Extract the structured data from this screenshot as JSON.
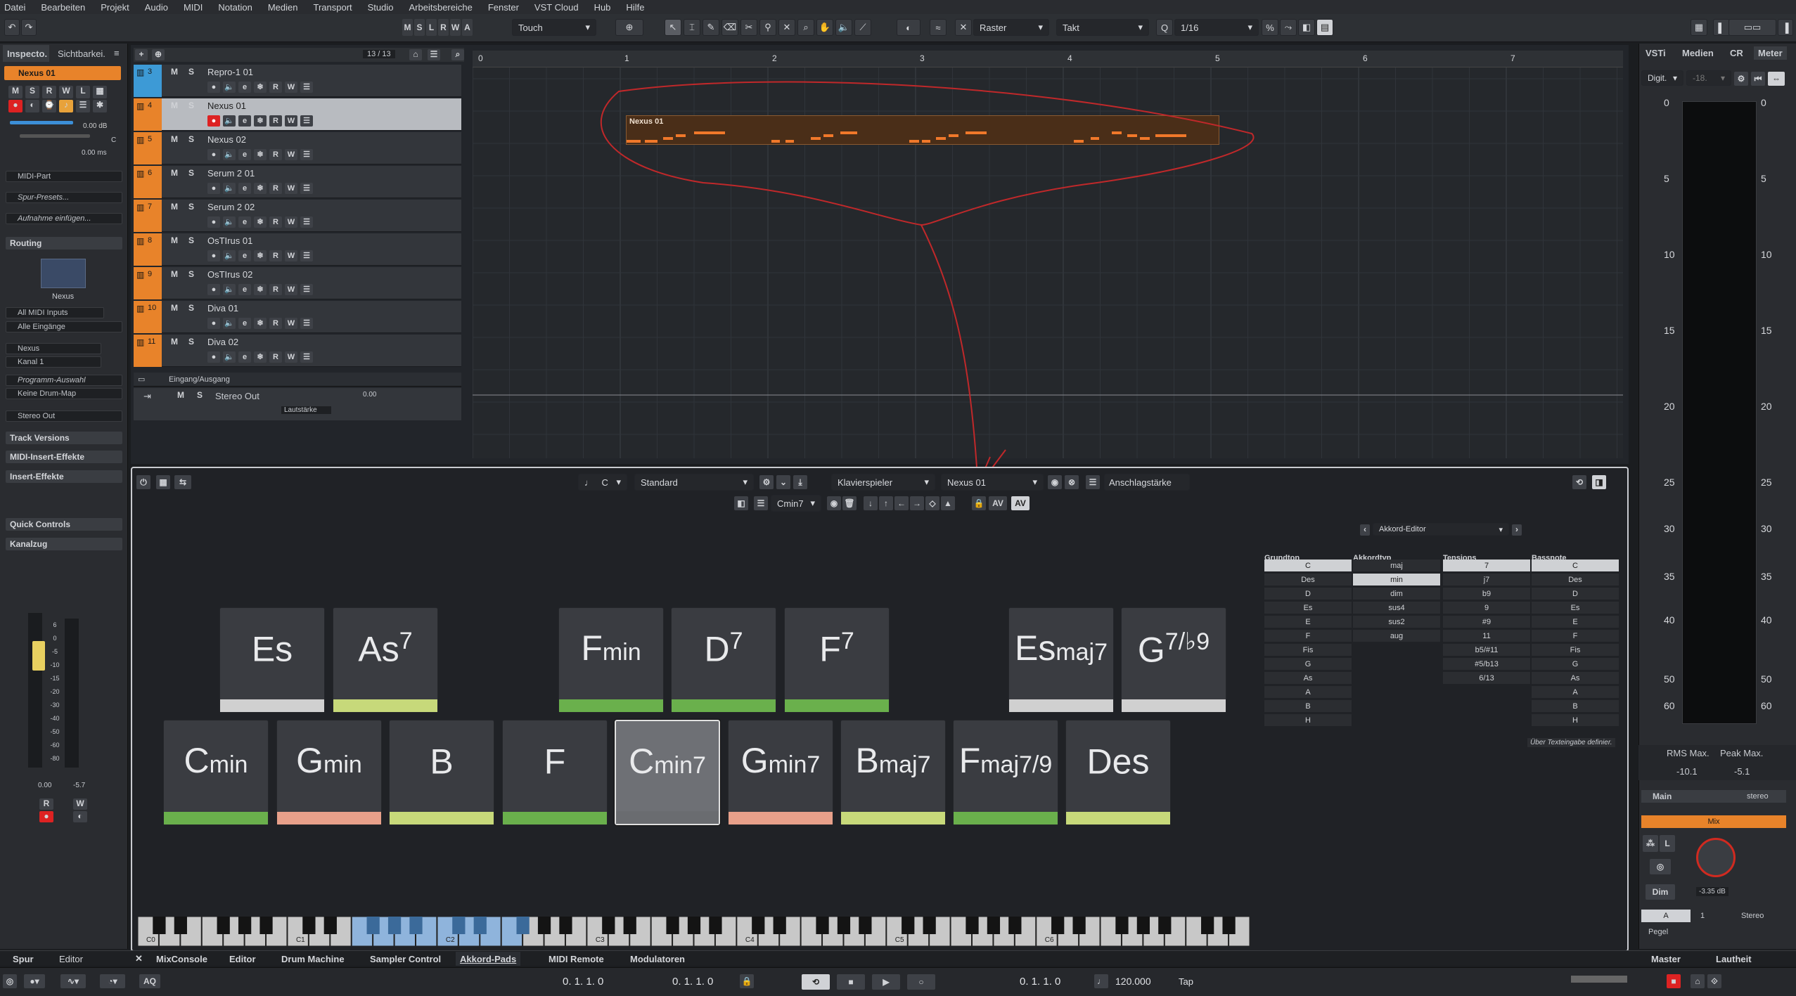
{
  "menu": [
    "Datei",
    "Bearbeiten",
    "Projekt",
    "Audio",
    "MIDI",
    "Notation",
    "Medien",
    "Transport",
    "Studio",
    "Arbeitsbereiche",
    "Fenster",
    "VST Cloud",
    "Hub",
    "Hilfe"
  ],
  "toolbar": {
    "modes": [
      "M",
      "S",
      "L",
      "R",
      "W",
      "A"
    ],
    "automation_mode": "Touch",
    "snap_type": "Raster",
    "grid_type": "Takt",
    "quantize": "1/16"
  },
  "left_panel": {
    "tabs": [
      "Inspecto.",
      "Sichtbarkei."
    ],
    "track_name": "Nexus 01",
    "volume": "0.00 dB",
    "delay": "0.00 ms",
    "pan": "C",
    "midi_part": "MIDI-Part",
    "presets": "Spur-Presets...",
    "record_insert": "Aufnahme einfügen...",
    "routing_label": "Routing",
    "instrument": "Nexus",
    "input": "All MIDI Inputs",
    "input_sub": "Alle Eingänge",
    "output": "Nexus",
    "channel": "Kanal 1",
    "program": "Programm-Auswahl",
    "drum_map": "Keine Drum-Map",
    "stereo_out": "Stereo Out",
    "sections": [
      "Track Versions",
      "MIDI-Insert-Effekte",
      "Insert-Effekte",
      "Quick Controls",
      "Kanalzug"
    ],
    "fader_values": [
      "0.00",
      "-5.7"
    ],
    "fader_scale": [
      "6",
      "0",
      "-5",
      "-10",
      "-15",
      "-20",
      "-30",
      "-40",
      "-50",
      "-60",
      "-80"
    ]
  },
  "track_list": {
    "counter": "13 / 13",
    "tracks": [
      {
        "num": "3",
        "name": "Repro-1 01",
        "color": "#3d9ad6"
      },
      {
        "num": "4",
        "name": "Nexus 01",
        "color": "#e8832a",
        "selected": true
      },
      {
        "num": "5",
        "name": "Nexus 02",
        "color": "#e8832a"
      },
      {
        "num": "6",
        "name": "Serum 2 01",
        "color": "#e8832a"
      },
      {
        "num": "7",
        "name": "Serum 2 02",
        "color": "#e8832a"
      },
      {
        "num": "8",
        "name": "OsTIrus 01",
        "color": "#e8832a"
      },
      {
        "num": "9",
        "name": "OsTIrus 02",
        "color": "#e8832a"
      },
      {
        "num": "10",
        "name": "Diva 01",
        "color": "#e8832a"
      },
      {
        "num": "11",
        "name": "Diva 02",
        "color": "#e8832a"
      }
    ],
    "folder": "Eingang/Ausgang",
    "stereo_out": {
      "name": "Stereo Out",
      "value": "0.00",
      "param": "Lautstärke"
    }
  },
  "ruler": {
    "bars": [
      "0",
      "1",
      "2",
      "3",
      "4",
      "5",
      "6",
      "7"
    ]
  },
  "midi_part": {
    "name": "Nexus 01"
  },
  "chord_pads_toolbar": {
    "key": "C",
    "mode": "Standard",
    "player": "Klavierspieler",
    "target": "Nexus 01",
    "velocity": "Anschlagstärke",
    "chord": "Cmin7"
  },
  "pads_top": [
    {
      "root": "Es",
      "ext": "",
      "strip": "#d0d0d0"
    },
    {
      "root": "As",
      "ext": "7",
      "strip": "#c7d97a"
    },
    {
      "root": "F",
      "ext": "min",
      "strip": "#6ab04c"
    },
    {
      "root": "D",
      "ext": "7",
      "strip": "#6ab04c"
    },
    {
      "root": "F",
      "ext": "7",
      "strip": "#6ab04c"
    },
    {
      "root": "Es",
      "ext": "maj7",
      "strip": "#d0d0d0"
    },
    {
      "root": "G",
      "ext": "7/♭9",
      "strip": "#d0d0d0"
    }
  ],
  "pads_bottom": [
    {
      "root": "C",
      "ext": "min",
      "strip": "#6ab04c"
    },
    {
      "root": "G",
      "ext": "min",
      "strip": "#e8a08a"
    },
    {
      "root": "B",
      "ext": "",
      "strip": "#c7d97a"
    },
    {
      "root": "F",
      "ext": "",
      "strip": "#6ab04c"
    },
    {
      "root": "C",
      "ext": "min7",
      "strip": "#6a6c70",
      "selected": true
    },
    {
      "root": "G",
      "ext": "min7",
      "strip": "#e8a08a"
    },
    {
      "root": "B",
      "ext": "maj7",
      "strip": "#c7d97a"
    },
    {
      "root": "F",
      "ext": "maj7/9",
      "strip": "#6ab04c"
    },
    {
      "root": "Des",
      "ext": "",
      "strip": "#c7d97a"
    }
  ],
  "keyboard_labels": [
    "C0",
    "C1",
    "C2",
    "C3",
    "C4",
    "C5",
    "C6"
  ],
  "chord_editor": {
    "title": "Akkord-Editor",
    "headers": [
      "Grundton",
      "Akkordtyp",
      "Tensions",
      "Bassnote"
    ],
    "grundton": [
      "C",
      "Des",
      "D",
      "Es",
      "E",
      "F",
      "Fis",
      "G",
      "As",
      "A",
      "B",
      "H"
    ],
    "akkordtyp": [
      "maj",
      "min",
      "dim",
      "sus4",
      "sus2",
      "aug"
    ],
    "tensions": [
      "7",
      "j7",
      "b9",
      "9",
      "#9",
      "11",
      "b5/#11",
      "#5/b13",
      "6/13"
    ],
    "bassnote": [
      "C",
      "Des",
      "D",
      "Es",
      "E",
      "F",
      "Fis",
      "G",
      "As",
      "A",
      "B",
      "H"
    ],
    "text_input": "Über Texteingabe definier."
  },
  "right_panel": {
    "tabs": [
      "VSTi",
      "Medien",
      "CR",
      "Meter"
    ],
    "meter_mode": "Digit.",
    "meter_value": "-18.",
    "scale": [
      "0",
      "5",
      "10",
      "15",
      "20",
      "25",
      "30",
      "35",
      "40",
      "50",
      "60"
    ],
    "rms_label": "RMS Max.",
    "peak_label": "Peak Max.",
    "rms_value": "-10.1",
    "peak_value": "-5.1",
    "main_label": "Main",
    "main_mode": "stereo",
    "mix_label": "Mix",
    "dim_label": "Dim",
    "gain": "-3.35 dB",
    "channel_a": "A",
    "channel_num": "1",
    "channel_stereo": "Stereo",
    "pegel": "Pegel",
    "bottom_tabs": [
      "Master",
      "Lautheit"
    ]
  },
  "bottom_tabs": {
    "left": [
      "Spur",
      "Editor"
    ],
    "lower": [
      "MixConsole",
      "Editor",
      "Drum Machine",
      "Sampler Control",
      "Akkord-Pads",
      "MIDI Remote",
      "Modulatoren"
    ]
  },
  "transport": {
    "left_locator": "0. 1. 1.   0",
    "right_locator": "0. 1. 1.   0",
    "position": "0. 1. 1.   0",
    "tempo": "120.000",
    "tap": "Tap",
    "aq": "AQ"
  }
}
